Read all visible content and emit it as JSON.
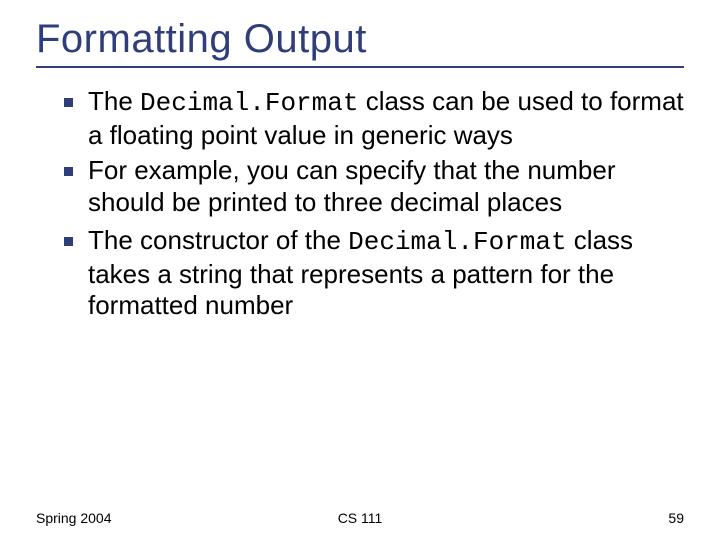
{
  "title": "Formatting Output",
  "bullets": [
    {
      "pre": "The ",
      "code": "Decimal.Format",
      "post": " class can be used to format a floating point value in generic ways"
    },
    {
      "pre": "For example, you can specify that the number should be printed to three decimal places",
      "code": "",
      "post": ""
    },
    {
      "pre": "The constructor of the ",
      "code": "Decimal.Format",
      "post": " class takes a string that represents a pattern for the formatted number"
    }
  ],
  "footer": {
    "left": "Spring 2004",
    "center": "CS 111",
    "right": "59"
  }
}
